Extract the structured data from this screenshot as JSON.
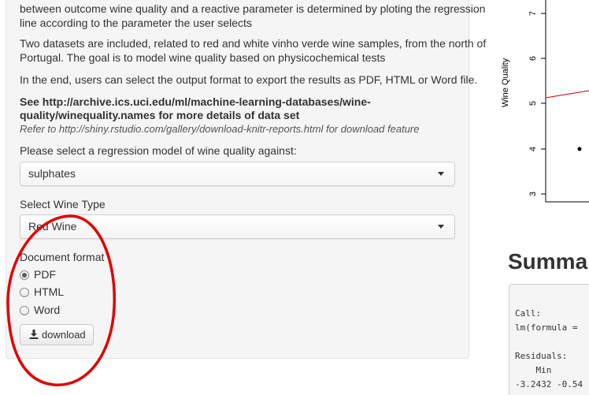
{
  "sidebar": {
    "intro_line1": "between outcome wine quality and a reactive parameter is determined by ploting the regression",
    "intro_line2": "line according to the parameter the user selects",
    "datasets_line1": "Two datasets are included, related to red and white vinho verde wine samples, from the north of",
    "datasets_line2": "Portugal. The goal is to model wine quality based on physicochemical tests",
    "export_line": "In the end, users can select the output format to export the results as PDF, HTML or Word file.",
    "see_line1": "See http://archive.ics.uci.edu/ml/machine-learning-databases/wine-",
    "see_line2": "quality/winequality.names for more details of data set",
    "refer_line": "Refer to http://shiny.rstudio.com/gallery/download-knitr-reports.html for download feature",
    "model_label": "Please select a regression model of wine quality against:",
    "model_value": "sulphates",
    "wine_label": "Select Wine Type",
    "wine_value": "Red Wine",
    "format_label": "Document format",
    "format_options": [
      {
        "label": "PDF",
        "checked": true
      },
      {
        "label": "HTML",
        "checked": false
      },
      {
        "label": "Word",
        "checked": false
      }
    ],
    "download_label": "download",
    "download_icon": "download-icon"
  },
  "annotation": {
    "color": "#e00000",
    "shape": "ellipse"
  },
  "plot": {
    "ylabel": "Wine Quality",
    "y_ticks": [
      "7",
      "6",
      "5",
      "4",
      "3"
    ],
    "regression_line_color": "#c00000"
  },
  "summary": {
    "heading": "Summa",
    "lines": [
      "Call:",
      "lm(formula = ",
      "",
      "Residuals:",
      "    Min     ",
      "-3.2432 -0.54"
    ]
  }
}
